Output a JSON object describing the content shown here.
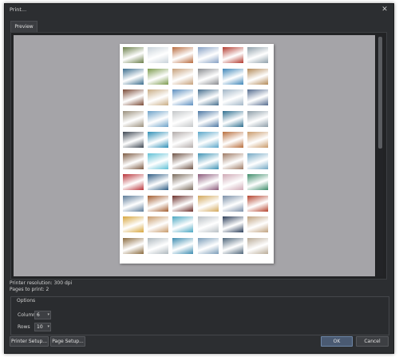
{
  "window": {
    "title": "Print..."
  },
  "tabs": [
    {
      "label": "Preview"
    }
  ],
  "preview": {
    "columns": 6,
    "rows": 10,
    "thumb_colors": [
      "#6b7f4a",
      "#c9d3da",
      "#b86b3e",
      "#86a0c4",
      "#b23a2e",
      "#8fa0aa",
      "#3b6d8d",
      "#7c9b4e",
      "#c6a07a",
      "#8a8c90",
      "#3f86b8",
      "#b38a58",
      "#7a4a36",
      "#c9ad85",
      "#5d8fbf",
      "#48708f",
      "#a2b6c7",
      "#556c8f",
      "#9a8f7c",
      "#6ca1c8",
      "#c4c7c9",
      "#4c77a3",
      "#2f6f8f",
      "#8d9da8",
      "#3e4752",
      "#2f8fb6",
      "#b3acaa",
      "#5aa6c9",
      "#b86e3c",
      "#c99a6a",
      "#7d5b43",
      "#5fc0d6",
      "#6f5446",
      "#3f93b5",
      "#9e7a64",
      "#73a8c4",
      "#b9343a",
      "#2f5d84",
      "#7a6b5c",
      "#8b5a7a",
      "#cfa9b5",
      "#3e8c6a",
      "#5c7b98",
      "#a35d2f",
      "#6c2f2a",
      "#d3a85b",
      "#7b8fa8",
      "#b4422c",
      "#d7a53c",
      "#c89a6a",
      "#4aa7c2",
      "#b9c0c5",
      "#2d3f5a",
      "#c0a27f",
      "#8a6a3e",
      "#aeb8be",
      "#3c8cb0",
      "#7a9cb8",
      "#4f667a",
      "#b9ab97"
    ]
  },
  "info": {
    "printer_resolution": "Printer resolution: 300 dpi",
    "pages_to_print": "Pages to print: 2"
  },
  "options": {
    "title": "Options",
    "columns_label": "Columns",
    "columns_value": "6",
    "rows_label": "Rows",
    "rows_value": "10"
  },
  "buttons": {
    "printer_setup": "Printer Setup...",
    "page_setup": "Page Setup...",
    "ok": "OK",
    "cancel": "Cancel"
  },
  "icons": {
    "close": "close-icon",
    "stepper_arrow": "chevron-down-icon"
  }
}
